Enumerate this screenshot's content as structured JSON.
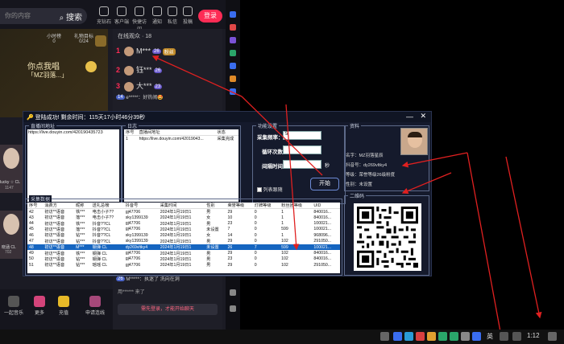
{
  "live": {
    "search_placeholder": "你的内容",
    "search_button": "搜索",
    "nav": [
      "充钻石",
      "客户端",
      "快捷访问",
      "通知",
      "私信",
      "投稿"
    ],
    "login": "登录",
    "stage_stats": [
      {
        "label": "小时榜",
        "value": "0"
      },
      {
        "label": "礼物目标",
        "value": "0/24"
      }
    ],
    "stage_song": "你点我唱",
    "stage_song_sub": "「MZ羽落...」",
    "online_label": "在线观众 · 18",
    "viewers": [
      {
        "rank": "1",
        "name": "M***",
        "tag1": "26",
        "tag2": "粉丝"
      },
      {
        "rank": "2",
        "name": "钰***",
        "tag1": "26",
        "tag2": ""
      },
      {
        "rank": "3",
        "name": "大***",
        "tag1": "23",
        "tag2": ""
      }
    ],
    "chat1_badge": "14",
    "chat1": "e*****：好热闹🤩",
    "chat2_badge": "26",
    "chat2_user": "M*****",
    "chat2": "M*****：执迷了 洗向在洞",
    "chat3": "用****** 来了",
    "chat_input_note": "需先登录，才能开始聊天",
    "left_cards": [
      {
        "name": "lucky ☆ CL",
        "count": "1147"
      },
      {
        "name": "晓涵 CL",
        "count": "702"
      }
    ],
    "bottom_buttons": [
      "一起音乐",
      "更多",
      "充值",
      "申请连线"
    ],
    "accent": "#fe2c55"
  },
  "tool": {
    "title": "登陆成功! 剩余时间：115天17小时46分39秒",
    "live_url_group": "直播间地址",
    "live_url": "https://live.douyin.com/420190435723",
    "log_group": "日志",
    "log_columns": [
      "序号",
      "直播间地址",
      "状态"
    ],
    "log_rows": [
      [
        "1",
        "https://live.douyin.com/42019043...",
        "采集完成"
      ]
    ],
    "settings_group": "功能设置",
    "interval_label": "采集频率：",
    "interval_value": "5",
    "loop_label": "循环次数：",
    "loop_value": "",
    "gap_label": "间隔时间：",
    "gap_value": "",
    "gap_unit": "秒",
    "follow_label": "列表跟随",
    "start_button": "开始",
    "info_group": "资料",
    "info_name": "名字：MZ羽落星辰",
    "info_douyin": "抖音号：dy269vltky4",
    "info_level": "等级：荣誉等级26级粉度",
    "info_gender": "性别：未设置",
    "data_group": "采集数据",
    "data_columns": [
      "序号",
      "消费方",
      "昵称",
      "送礼总榜",
      "抖音号",
      "采集时间",
      "性别",
      "荣誉等级",
      "灯牌等级",
      "粉丝团等级",
      "UID"
    ],
    "data_rows": [
      [
        "42",
        "初访**语音",
        "铁***",
        "电击小子??",
        "gj47706",
        "2024年1月19日1",
        "男",
        "29",
        "0",
        "1",
        "840016..."
      ],
      [
        "43",
        "初访**语音",
        "落***",
        "电击小子??",
        "sky1399139",
        "2024年1月19日1",
        "女",
        "10",
        "0",
        "1",
        "840016..."
      ],
      [
        "44",
        "初访**语音",
        "铁***",
        "抖音??CL",
        "gj47706",
        "2024年1月19日1",
        "男",
        "23",
        "0",
        "1",
        "100021..."
      ],
      [
        "45",
        "初访**语音",
        "落***",
        "抖音??CL",
        "gj47706",
        "2024年1月19日1",
        "未设置",
        "7",
        "0",
        "599",
        "100021..."
      ],
      [
        "46",
        "初访**语音",
        "钻***",
        "抖音??CL",
        "sky1399139",
        "2024年1月19日1",
        "女",
        "14",
        "0",
        "1",
        "968096..."
      ],
      [
        "47",
        "初访**语音",
        "钻***",
        "抖音??CL",
        "sky1399139",
        "2024年1月19日1",
        "男",
        "29",
        "0",
        "102",
        "291050..."
      ],
      [
        "48",
        "初访**语音",
        "M***",
        "钢弹 CL",
        "dy269vltky4",
        "2024年1月19日1",
        "未设置",
        "26",
        "7",
        "599",
        "100021..."
      ],
      [
        "49",
        "初访**语音",
        "铁***",
        "钢弹 CL",
        "gj47706",
        "2024年1月19日1",
        "男",
        "29",
        "0",
        "102",
        "840016..."
      ],
      [
        "50",
        "初访**语音",
        "钻***",
        "钢弹 CL",
        "gj47706",
        "2024年1月19日1",
        "男",
        "23",
        "0",
        "102",
        "840016..."
      ],
      [
        "51",
        "初访**语音",
        "钻***",
        "瑶瑶 CL",
        "gj47706",
        "2024年1月19日1",
        "男",
        "29",
        "0",
        "102",
        "291050..."
      ]
    ],
    "selected_row_index": 6,
    "qr_group": "二维码"
  },
  "taskbar": {
    "lang": "英",
    "time": "1:12"
  }
}
